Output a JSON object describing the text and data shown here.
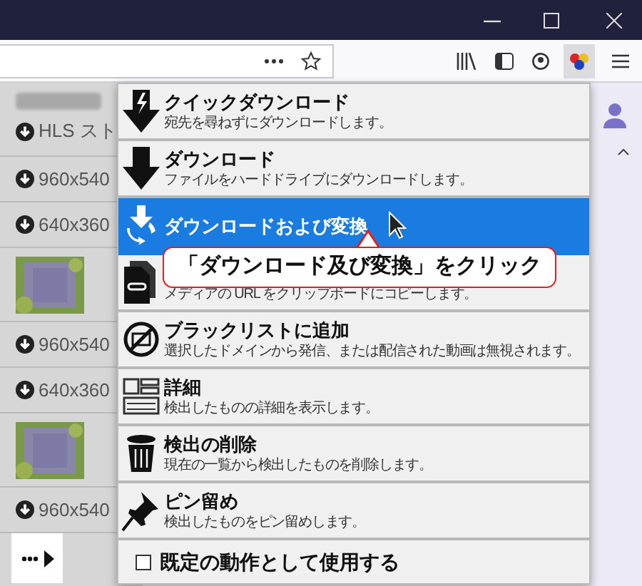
{
  "media_list": [
    {
      "kind": "stream",
      "label": "HLS スト"
    },
    {
      "kind": "variant",
      "label": "960x540"
    },
    {
      "kind": "variant",
      "label": "640x360"
    },
    {
      "kind": "thumbnail"
    },
    {
      "kind": "variant",
      "label": "960x540"
    },
    {
      "kind": "variant",
      "label": "640x360"
    },
    {
      "kind": "thumbnail"
    },
    {
      "kind": "variant",
      "label": "960x540"
    }
  ],
  "menu": {
    "items": [
      {
        "kind": "quick",
        "title": "クイックダウンロード",
        "description": "宛先を尋ねずにダウンロードします。",
        "selected": false
      },
      {
        "kind": "download",
        "title": "ダウンロード",
        "description": "ファイルをハードドライブにダウンロードします。",
        "selected": false
      },
      {
        "kind": "convert",
        "title": "ダウンロードおよび変換",
        "selected": true
      },
      {
        "kind": "copy",
        "description": "メディアの URL をクリップボードにコピーします。",
        "selected": false
      },
      {
        "kind": "blacklist",
        "title": "ブラックリストに追加",
        "description": "選択したドメインから発信、または配信された動画は無視されます。",
        "selected": false
      },
      {
        "kind": "details",
        "title": "詳細",
        "description": "検出したものの詳細を表示します。",
        "selected": false
      },
      {
        "kind": "delete",
        "title": "検出の削除",
        "description": "現在の一覧から検出したものを削除します。",
        "selected": false
      },
      {
        "kind": "pin",
        "title": "ピン留め",
        "description": "検出したものをピン留めします。",
        "selected": false
      }
    ],
    "default_action": {
      "label": "既定の動作として使用する",
      "checked": false
    }
  },
  "callout": {
    "text": "「ダウンロード及び変換」をクリック"
  }
}
